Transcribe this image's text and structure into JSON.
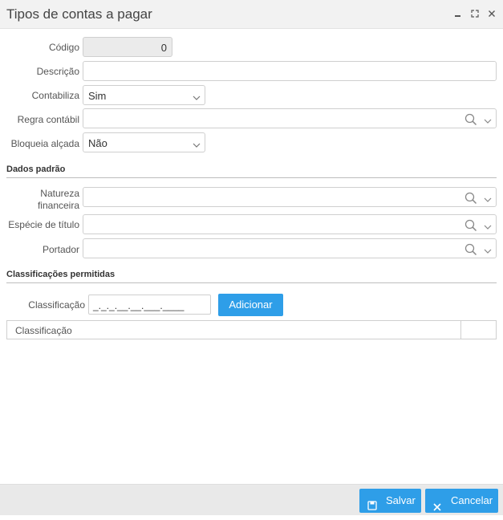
{
  "window": {
    "title": "Tipos de contas a pagar"
  },
  "form": {
    "codigo": {
      "label": "Código",
      "value": "0"
    },
    "descricao": {
      "label": "Descrição",
      "value": ""
    },
    "contabiliza": {
      "label": "Contabiliza",
      "value": "Sim"
    },
    "regra_contabil": {
      "label": "Regra contábil",
      "value": ""
    },
    "bloqueia_alcada": {
      "label": "Bloqueia alçada",
      "value": "Não"
    }
  },
  "dados_padrao": {
    "heading": "Dados padrão",
    "natureza_label_1": "Natureza",
    "natureza_label_2": "financeira",
    "especie_label": "Espécie de título",
    "portador_label": "Portador"
  },
  "classificacoes": {
    "heading": "Classificações permitidas",
    "label": "Classificação",
    "mask_value": "_._._.__.__.___.____",
    "add_button": "Adicionar",
    "grid_header": "Classificação"
  },
  "footer": {
    "save_label": "Salvar",
    "cancel_label": "Cancelar"
  },
  "colors": {
    "accent": "#2e9ee8",
    "titlebar": "#f2f2f2",
    "footer": "#e9e9e9"
  },
  "icons": [
    "minimize-icon",
    "maximize-icon",
    "close-icon",
    "chevron-down-icon",
    "search-icon",
    "save-icon",
    "cancel-x-icon"
  ]
}
